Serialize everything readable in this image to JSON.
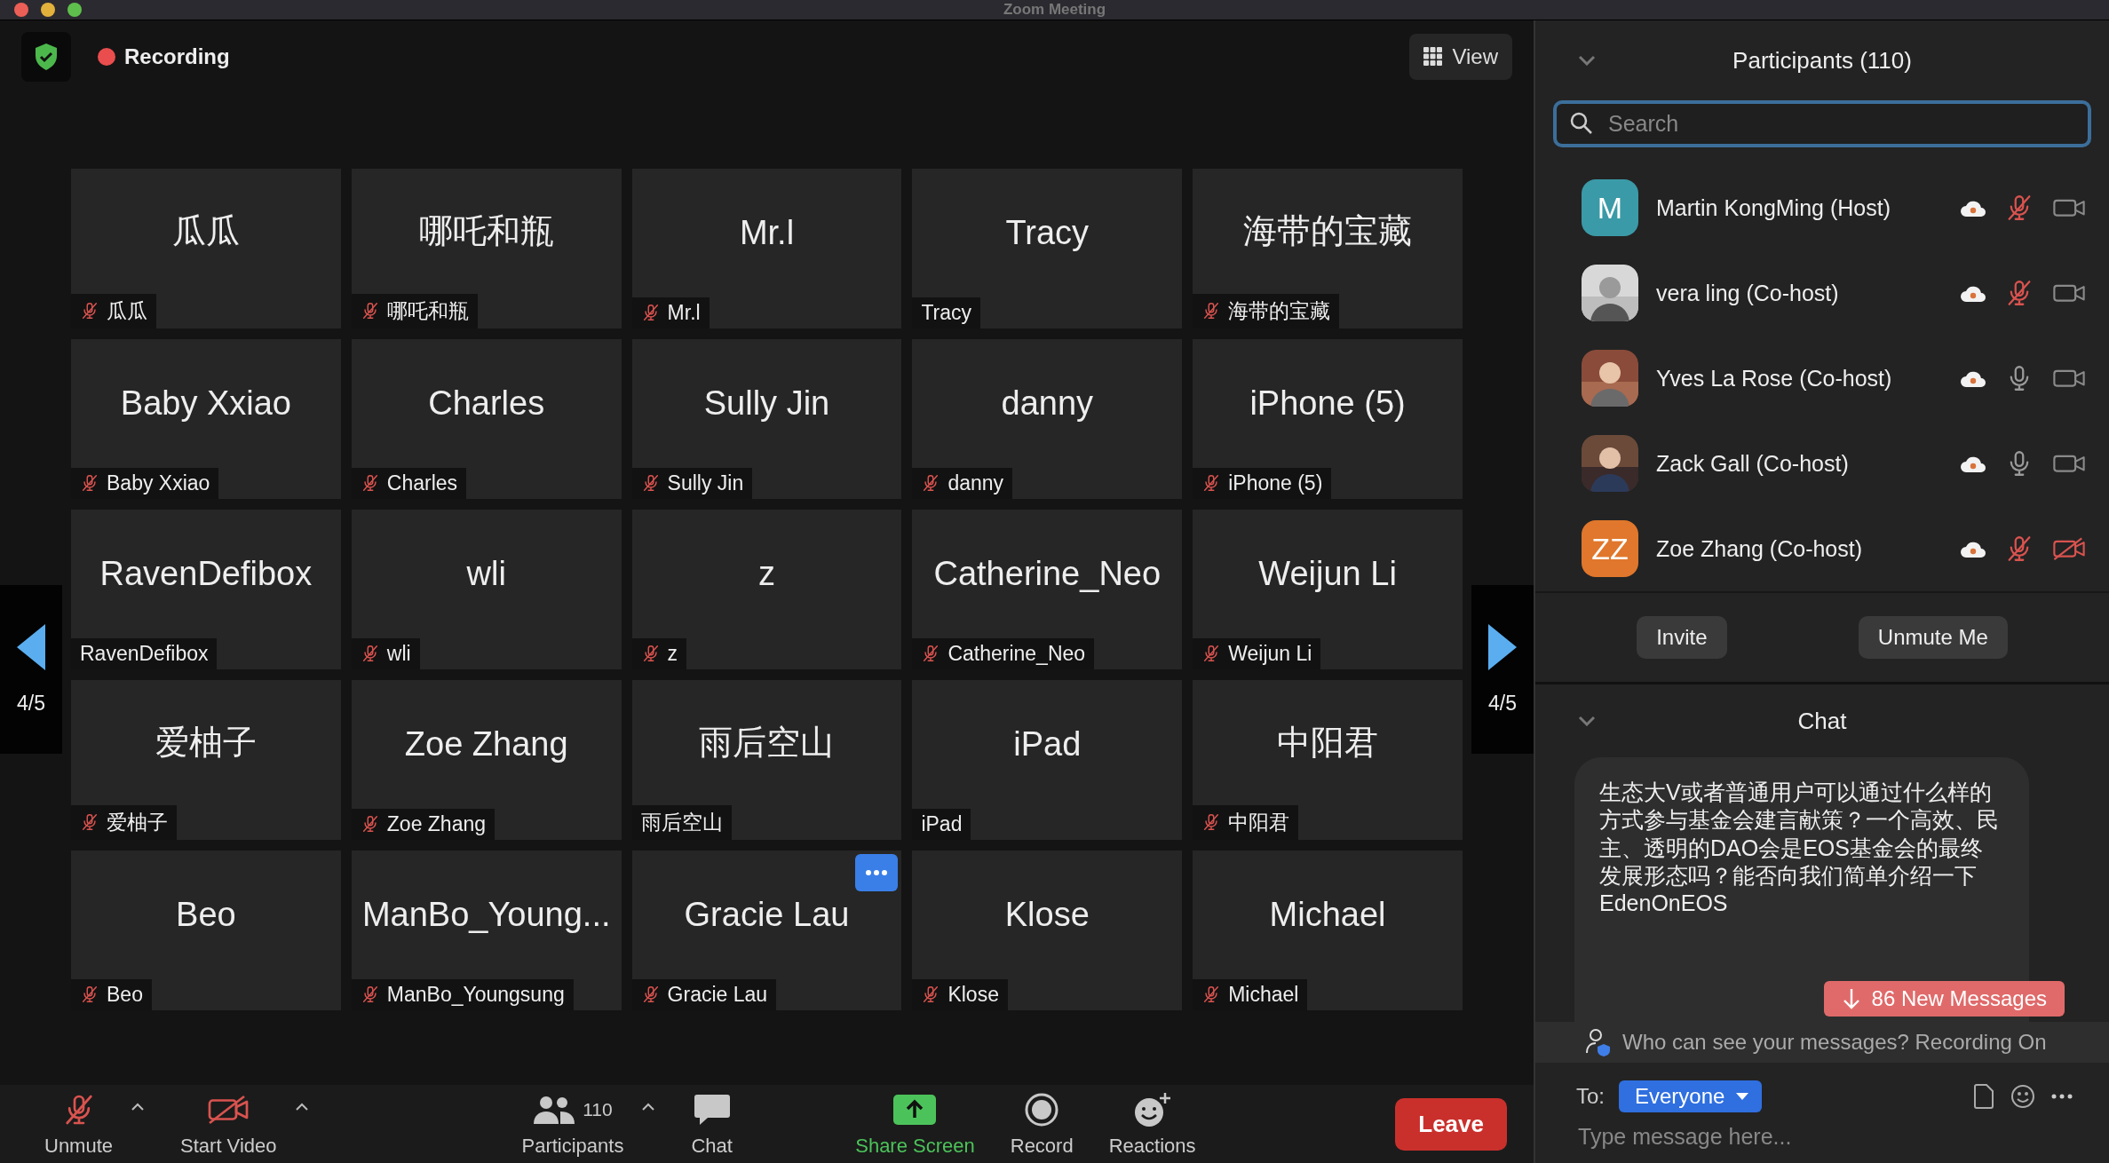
{
  "window": {
    "title": "Zoom Meeting"
  },
  "top_bar": {
    "recording_label": "Recording",
    "view_button": "View"
  },
  "pager": {
    "left": "4/5",
    "right": "4/5"
  },
  "tiles": [
    {
      "name": "瓜瓜",
      "label": "瓜瓜",
      "muted": true,
      "hovered": false
    },
    {
      "name": "哪吒和瓶",
      "label": "哪吒和瓶",
      "muted": true,
      "hovered": false
    },
    {
      "name": "Mr.l",
      "label": "Mr.l",
      "muted": true,
      "hovered": false
    },
    {
      "name": "Tracy",
      "label": "Tracy",
      "muted": false,
      "hovered": false
    },
    {
      "name": "海带的宝藏",
      "label": "海带的宝藏",
      "muted": true,
      "hovered": false
    },
    {
      "name": "Baby Xxiao",
      "label": "Baby Xxiao",
      "muted": true,
      "hovered": false
    },
    {
      "name": "Charles",
      "label": "Charles",
      "muted": true,
      "hovered": false
    },
    {
      "name": "Sully Jin",
      "label": "Sully Jin",
      "muted": true,
      "hovered": false
    },
    {
      "name": "danny",
      "label": "danny",
      "muted": true,
      "hovered": false
    },
    {
      "name": "iPhone (5)",
      "label": "iPhone (5)",
      "muted": true,
      "hovered": false
    },
    {
      "name": "RavenDefibox",
      "label": "RavenDefibox",
      "muted": false,
      "hovered": false
    },
    {
      "name": "wli",
      "label": "wli",
      "muted": true,
      "hovered": false
    },
    {
      "name": "z",
      "label": "z",
      "muted": true,
      "hovered": false
    },
    {
      "name": "Catherine_Neo",
      "label": "Catherine_Neo",
      "muted": true,
      "hovered": false
    },
    {
      "name": "Weijun Li",
      "label": "Weijun Li",
      "muted": true,
      "hovered": false
    },
    {
      "name": "爱柚子",
      "label": "爱柚子",
      "muted": true,
      "hovered": false
    },
    {
      "name": "Zoe Zhang",
      "label": "Zoe Zhang",
      "muted": true,
      "hovered": false
    },
    {
      "name": "雨后空山",
      "label": "雨后空山",
      "muted": false,
      "hovered": false
    },
    {
      "name": "iPad",
      "label": "iPad",
      "muted": false,
      "hovered": false
    },
    {
      "name": "中阳君",
      "label": "中阳君",
      "muted": true,
      "hovered": false
    },
    {
      "name": "Beo",
      "label": "Beo",
      "muted": true,
      "hovered": false
    },
    {
      "name": "ManBo_Young...",
      "label": "ManBo_Youngsung",
      "muted": true,
      "hovered": false
    },
    {
      "name": "Gracie Lau",
      "label": "Gracie Lau",
      "muted": true,
      "hovered": true
    },
    {
      "name": "Klose",
      "label": "Klose",
      "muted": true,
      "hovered": false
    },
    {
      "name": "Michael",
      "label": "Michael",
      "muted": true,
      "hovered": false
    }
  ],
  "toolbar": {
    "items": [
      {
        "kind": "mic",
        "label": "Unmute",
        "off": true,
        "caret": true
      },
      {
        "kind": "video",
        "label": "Start Video",
        "off": true,
        "caret": true
      },
      {
        "kind": "participants",
        "label": "Participants",
        "count": "110",
        "caret": true
      },
      {
        "kind": "chat",
        "label": "Chat",
        "caret": false
      },
      {
        "kind": "share",
        "label": "Share Screen",
        "caret": false
      },
      {
        "kind": "record",
        "label": "Record",
        "caret": false
      },
      {
        "kind": "reactions",
        "label": "Reactions",
        "caret": false
      }
    ],
    "leave": "Leave"
  },
  "participants": {
    "title": "Participants (110)",
    "search_placeholder": "Search",
    "rows": [
      {
        "avatar": {
          "kind": "initials",
          "text": "M",
          "color": "#3b9aa7"
        },
        "name": "Martin KongMing (Host)",
        "muted": true,
        "video_off": false
      },
      {
        "name": "vera ling (Co-host)",
        "muted": true,
        "video_off": false
      },
      {
        "name": "Yves La Rose (Co-host)",
        "muted": false,
        "video_off": false
      },
      {
        "name": "Zack Gall (Co-host)",
        "muted": false,
        "video_off": false
      },
      {
        "avatar": {
          "kind": "initials",
          "text": "ZZ",
          "color": "#e0772c"
        },
        "name": "Zoe Zhang (Co-host)",
        "muted": true,
        "video_off": true
      }
    ],
    "buttons": [
      "Invite",
      "Unmute Me"
    ]
  },
  "chat": {
    "title": "Chat",
    "messages": [
      {
        "text": "生态大V或者普通用户可以通过什么样的方式参与基金会建言献策？一个高效、民主、透明的DAO会是EOS基金会的最终发展形态吗？能否向我们简单介绍一下EdenOnEOS"
      }
    ],
    "new_messages": "86 New Messages",
    "privacy_note": "Who can see your messages? Recording On",
    "to_label": "To:",
    "recipient": "Everyone",
    "placeholder": "Type message here..."
  }
}
